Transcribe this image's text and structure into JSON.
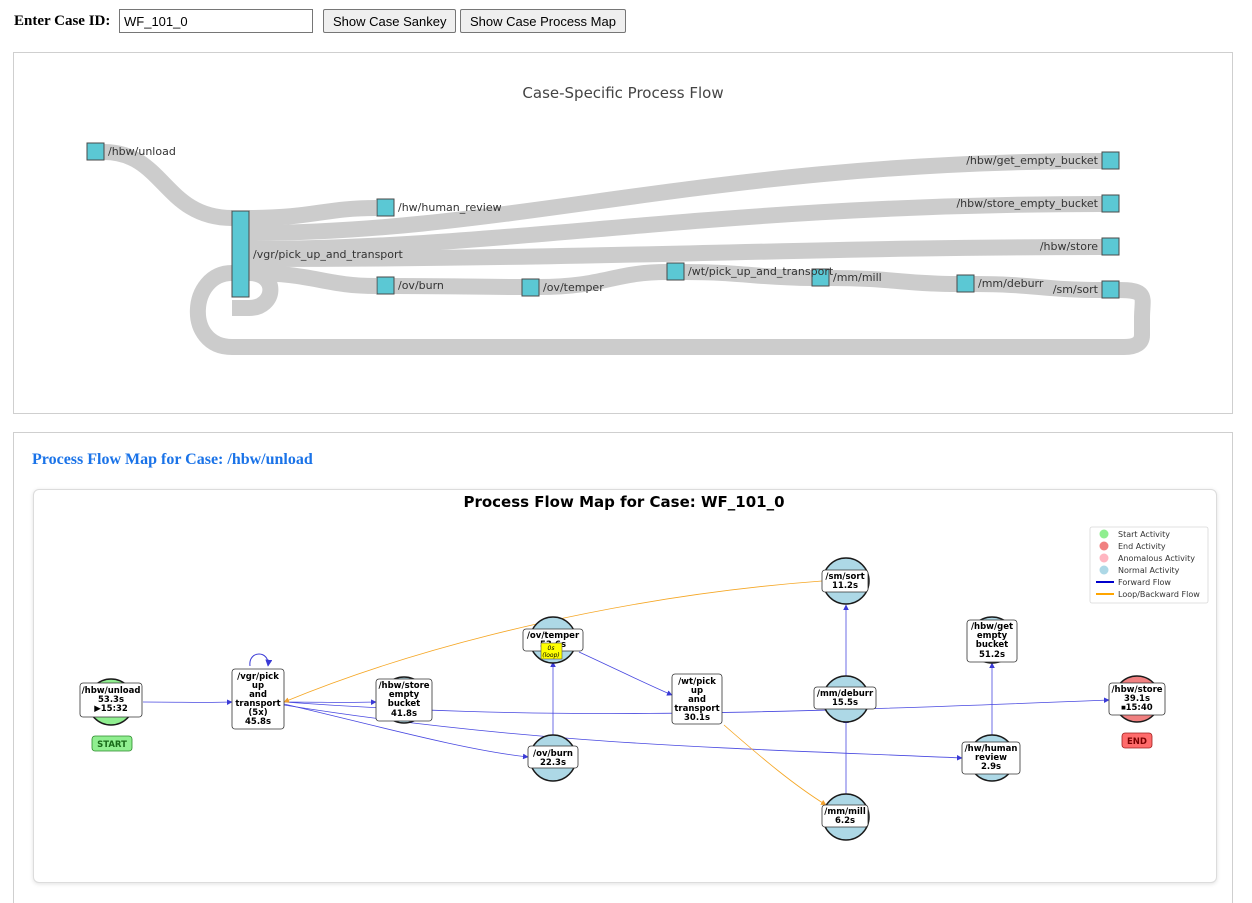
{
  "controls": {
    "case_label": "Enter Case ID:",
    "case_value": "WF_101_0",
    "sankey_button": "Show Case Sankey",
    "map_button": "Show Case Process Map"
  },
  "sankey": {
    "title": "Case-Specific Process Flow",
    "node_color": "#5bc8d4",
    "link_color": "#cccccc",
    "nodes": [
      {
        "id": "unload",
        "label": "/hbw/unload"
      },
      {
        "id": "vgr",
        "label": "/vgr/pick_up_and_transport"
      },
      {
        "id": "review",
        "label": "/hw/human_review"
      },
      {
        "id": "burn",
        "label": "/ov/burn"
      },
      {
        "id": "temper",
        "label": "/ov/temper"
      },
      {
        "id": "wt",
        "label": "/wt/pick_up_and_transport"
      },
      {
        "id": "mill",
        "label": "/mm/mill"
      },
      {
        "id": "deburr",
        "label": "/mm/deburr"
      },
      {
        "id": "getempty",
        "label": "/hbw/get_empty_bucket"
      },
      {
        "id": "storeempty",
        "label": "/hbw/store_empty_bucket"
      },
      {
        "id": "store",
        "label": "/hbw/store"
      },
      {
        "id": "sort",
        "label": "/sm/sort"
      }
    ]
  },
  "process_map": {
    "heading": "Process Flow Map for Case: /hbw/unload",
    "title": "Process Flow Map for Case: WF_101_0",
    "legend": [
      {
        "label": "Start Activity",
        "color": "#90ee90"
      },
      {
        "label": "End Activity",
        "color": "#f08080"
      },
      {
        "label": "Anomalous Activity",
        "color": "#ffb6c1"
      },
      {
        "label": "Normal Activity",
        "color": "#add8e6"
      },
      {
        "label": "Forward Flow",
        "color": "#0000cc"
      },
      {
        "label": "Loop/Backward Flow",
        "color": "#ffa500"
      }
    ],
    "nodes": [
      {
        "id": "unload",
        "lines": [
          "/hbw/unload",
          "53.3s",
          "▶15:32"
        ],
        "kind": "start"
      },
      {
        "id": "vgr",
        "lines": [
          "/vgr/pick",
          "up",
          "and",
          "transport",
          "(5x)",
          "45.8s"
        ],
        "kind": "normal"
      },
      {
        "id": "storeempty",
        "lines": [
          "/hbw/store",
          "empty",
          "bucket",
          "41.8s"
        ],
        "kind": "normal"
      },
      {
        "id": "temper",
        "lines": [
          "/ov/temper",
          "53.6s"
        ],
        "kind": "normal",
        "loop_badge": [
          "0s",
          "(loop)"
        ]
      },
      {
        "id": "burn",
        "lines": [
          "/ov/burn",
          "22.3s"
        ],
        "kind": "normal"
      },
      {
        "id": "wt",
        "lines": [
          "/wt/pick",
          "up",
          "and",
          "transport",
          "30.1s"
        ],
        "kind": "normal"
      },
      {
        "id": "sort",
        "lines": [
          "/sm/sort",
          "11.2s"
        ],
        "kind": "normal"
      },
      {
        "id": "deburr",
        "lines": [
          "/mm/deburr",
          "15.5s"
        ],
        "kind": "normal"
      },
      {
        "id": "mill",
        "lines": [
          "/mm/mill",
          "6.2s"
        ],
        "kind": "normal"
      },
      {
        "id": "getempty",
        "lines": [
          "/hbw/get",
          "empty",
          "bucket",
          "51.2s"
        ],
        "kind": "normal"
      },
      {
        "id": "review",
        "lines": [
          "/hw/human",
          "review",
          "2.9s"
        ],
        "kind": "normal"
      },
      {
        "id": "store",
        "lines": [
          "/hbw/store",
          "39.1s",
          "⏹15:40"
        ],
        "kind": "end"
      }
    ],
    "start_badge": "START",
    "end_badge": "END"
  }
}
